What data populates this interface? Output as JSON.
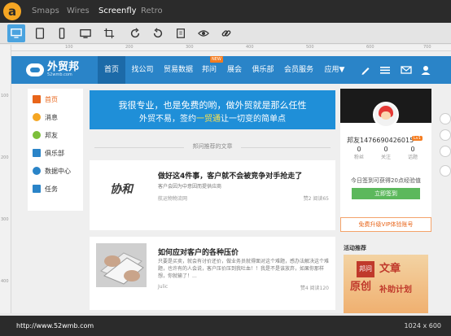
{
  "app": {
    "logo_letter": "a",
    "tabs": [
      "Smaps",
      "Wires",
      "Screenfly",
      "Retro"
    ],
    "active_tab": "Screenfly",
    "toolbar_icons": [
      "desktop-icon",
      "tablet-icon",
      "phone-icon",
      "tv-icon",
      "custom-size-icon",
      "rotate-icon",
      "refresh-icon",
      "preview-icon",
      "link-icon"
    ],
    "accent": "#4aa3df"
  },
  "ruler": {
    "top": [
      "100",
      "150",
      "200",
      "250",
      "300",
      "350",
      "400",
      "450",
      "500",
      "550",
      "600",
      "650",
      "700",
      "750",
      "800",
      "850",
      "900",
      "950",
      "1000"
    ],
    "left": [
      "100",
      "150",
      "200",
      "250",
      "300",
      "350",
      "400"
    ]
  },
  "site": {
    "logo_name": "外贸邦",
    "logo_domain": "52wmb.com",
    "nav": [
      "首页",
      "找公司",
      "贸易数据",
      "邦问",
      "展会",
      "俱乐部",
      "会员服务",
      "应用▼"
    ],
    "new_badge": "NEW",
    "nav_icons": [
      "edit-icon",
      "list-icon",
      "mail-icon",
      "user-icon"
    ],
    "left_menu": [
      {
        "label": "首页",
        "icon": "home-icon"
      },
      {
        "label": "消息",
        "icon": "message-icon"
      },
      {
        "label": "邦友",
        "icon": "friends-icon"
      },
      {
        "label": "俱乐部",
        "icon": "club-icon"
      },
      {
        "label": "数据中心",
        "icon": "data-center-icon"
      },
      {
        "label": "任务",
        "icon": "task-icon"
      }
    ],
    "banner": {
      "line1": "我很专业，也是免费的哟，做外贸就是那么任性",
      "line2_pre": "外贸不易，签约",
      "line2_highlight": "一贸通",
      "line2_post": "让一切变的简单点"
    },
    "section_title": "邦问推荐的文章",
    "articles": [
      {
        "title": "做好这4件事，客户就不会被竞争对手抢走了",
        "desc": "客户会因为中意因而提供应商",
        "source": "航运物物流网",
        "stats": "赞2  阅读65",
        "thumb_text": "协和"
      },
      {
        "title": "如何应对客户的各种压价",
        "desc": "只要是买卖，就会有讨价还价，做业务员就得面对这个难题，感办法解决这个难题，也许有的人会说，客户压价压到我吐血！！我是不是该放弃，如果你那样想，你就输了！...",
        "source": "Julic",
        "stats": "赞4  阅读120"
      }
    ],
    "profile": {
      "username": "邦友1476690426015",
      "level": "Lv1",
      "stats": [
        {
          "num": "0",
          "label": "粉丝"
        },
        {
          "num": "0",
          "label": "关注"
        },
        {
          "num": "0",
          "label": "话题"
        }
      ],
      "signin_text": "今日签到可获得20点经验值",
      "signin_button": "立即签到",
      "vip_button": "免费升级VIP体验账号"
    },
    "activity_title": "活动推荐",
    "activity_banner": {
      "line1": "原创",
      "line2": "文章",
      "line3": "补助计划",
      "tag": "邦问"
    }
  },
  "status": {
    "url": "http://www.52wmb.com",
    "resolution": "1024 x 600"
  }
}
